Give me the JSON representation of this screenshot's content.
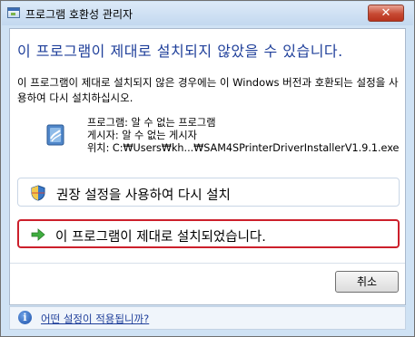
{
  "window": {
    "title": "프로그램 호환성 관리자",
    "close_label": "✕"
  },
  "main": {
    "heading": "이 프로그램이 제대로 설치되지 않았을 수 있습니다.",
    "description": "이 프로그램이 제대로 설치되지 않은 경우에는 이 Windows 버전과 호환되는 설정을 사용하여 다시 설치하십시오.",
    "program": {
      "name": "프로그램: 알 수 없는 프로그램",
      "publisher": "게시자: 알 수 없는 게시자",
      "location": "위치: C:₩Users₩kh...₩SAM4SPrinterDriverInstallerV1.9.1.exe"
    },
    "options": [
      {
        "label": "권장 설정을 사용하여 다시 설치",
        "icon": "shield-icon"
      },
      {
        "label": "이 프로그램이 제대로 설치되었습니다.",
        "icon": "green-arrow-icon"
      }
    ],
    "cancel_label": "취소"
  },
  "footer": {
    "help_link": "어떤 설정이 적용됩니까?"
  },
  "colors": {
    "heading": "#1f3f9a",
    "highlight_border": "#cc1f2b",
    "close_button": "#c74a33"
  }
}
